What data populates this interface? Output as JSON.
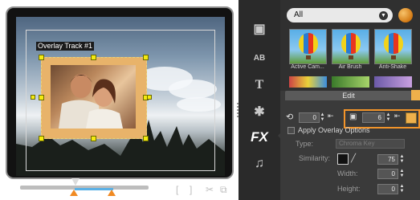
{
  "preview": {
    "overlay_label": "Overlay Track #1",
    "controls": {
      "mark_bracket_left": "[",
      "mark_bracket_right": "]",
      "cut_icon": "scissors-icon",
      "copy_icon": "copy-icon"
    }
  },
  "sidebar": {
    "items": [
      {
        "name": "media-icon",
        "glyph": "▣"
      },
      {
        "name": "transition-icon",
        "glyph": "AB"
      },
      {
        "name": "title-icon",
        "glyph": "T"
      },
      {
        "name": "graphic-icon",
        "glyph": "✱"
      },
      {
        "name": "fx-icon",
        "glyph": "FX"
      },
      {
        "name": "audio-icon",
        "glyph": "♫"
      }
    ]
  },
  "library": {
    "filter_value": "All",
    "thumbnails": [
      {
        "label": "Active Cam..."
      },
      {
        "label": "Air Brush"
      },
      {
        "label": "Anti-Shake"
      }
    ]
  },
  "options": {
    "tab_label": "Edit",
    "rotation_value": "0",
    "border_value": "6",
    "apply_overlay_label": "Apply Overlay Options",
    "type_label": "Type:",
    "type_value": "Chroma Key",
    "similarity_label": "Similarity:",
    "similarity_value": "75",
    "width_label": "Width:",
    "width_value": "0",
    "height_label": "Height:",
    "height_value": "0",
    "border_color": "#efb04b",
    "highlight_color": "#f2942a"
  }
}
